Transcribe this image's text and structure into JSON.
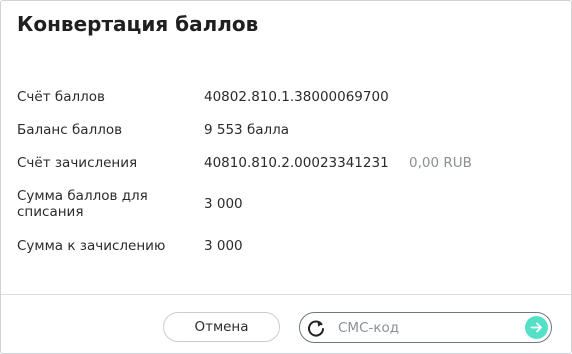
{
  "dialog": {
    "title": "Конвертация баллов"
  },
  "details": {
    "account": {
      "label": "Счёт баллов",
      "value": "40802.810.1.38000069700"
    },
    "balance": {
      "label": "Баланс баллов",
      "value": "9 553 балла"
    },
    "credit_account": {
      "label": "Счёт зачисления",
      "value": "40810.810.2.00023341231",
      "amount": "0,00 RUB"
    },
    "debit_sum": {
      "label": "Сумма баллов для списания",
      "value": "3 000"
    },
    "credit_sum": {
      "label": "Сумма к зачислению",
      "value": "3 000"
    }
  },
  "footer": {
    "cancel_label": "Отмена",
    "sms_placeholder": "СМС-код",
    "refresh_icon": "refresh-icon",
    "submit_icon": "arrow-right-icon"
  },
  "colors": {
    "accent": "#55e0c9",
    "muted_text": "#8a9197",
    "border": "#c9cdd1"
  }
}
